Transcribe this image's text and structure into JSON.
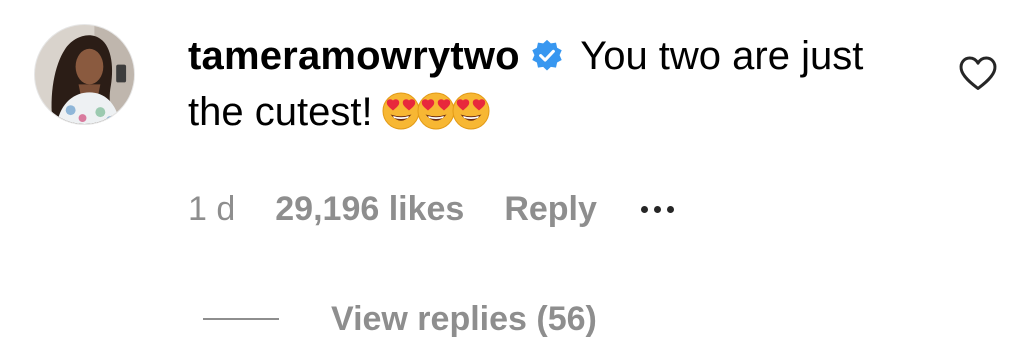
{
  "comment": {
    "username": "tameramowrytwo",
    "verified": true,
    "text": "You two are just the cutest!",
    "emojis": [
      "heart-eyes-emoji",
      "heart-eyes-emoji",
      "heart-eyes-emoji"
    ],
    "like_icon": "heart-outline-icon"
  },
  "meta": {
    "time": "1 d",
    "likes": "29,196 likes",
    "reply_label": "Reply",
    "more_icon": "more-horizontal-icon"
  },
  "replies": {
    "label": "View replies (56)"
  },
  "colors": {
    "text": "#000000",
    "secondary": "#8e8e8e",
    "verified_badge": "#3897f0"
  }
}
